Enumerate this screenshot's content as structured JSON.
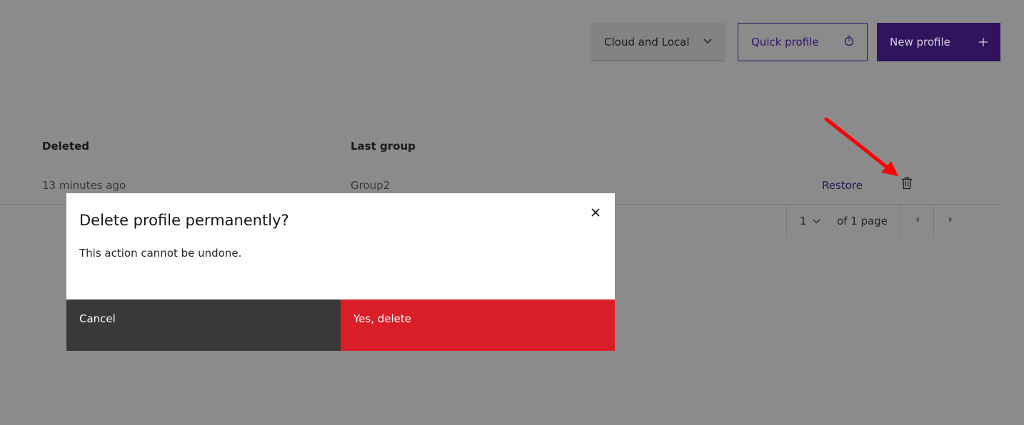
{
  "toolbar": {
    "storage_select": "Cloud and Local",
    "quick_profile_label": "Quick profile",
    "new_profile_label": "New profile"
  },
  "table": {
    "headers": [
      "Deleted",
      "Last group"
    ],
    "rows": [
      {
        "deleted": "13 minutes ago",
        "last_group": "Group2",
        "restore_label": "Restore"
      }
    ]
  },
  "pagination": {
    "page": "1",
    "of_label": "of 1 page"
  },
  "modal": {
    "title": "Delete profile permanently?",
    "body": "This action cannot be undone.",
    "cancel_label": "Cancel",
    "confirm_label": "Yes, delete"
  },
  "colors": {
    "overlay": "#8b8b8b",
    "brand_purple": "#31135e",
    "danger": "#da1e28",
    "secondary": "#393939",
    "annotation_arrow": "#ff0000"
  },
  "icons": {
    "dropdown": "chevron-down-icon",
    "quick_profile": "stopwatch-icon",
    "new_profile": "plus-icon",
    "delete_row": "trash-icon",
    "close_modal": "close-icon",
    "prev_page": "caret-left-icon",
    "next_page": "caret-right-icon"
  }
}
